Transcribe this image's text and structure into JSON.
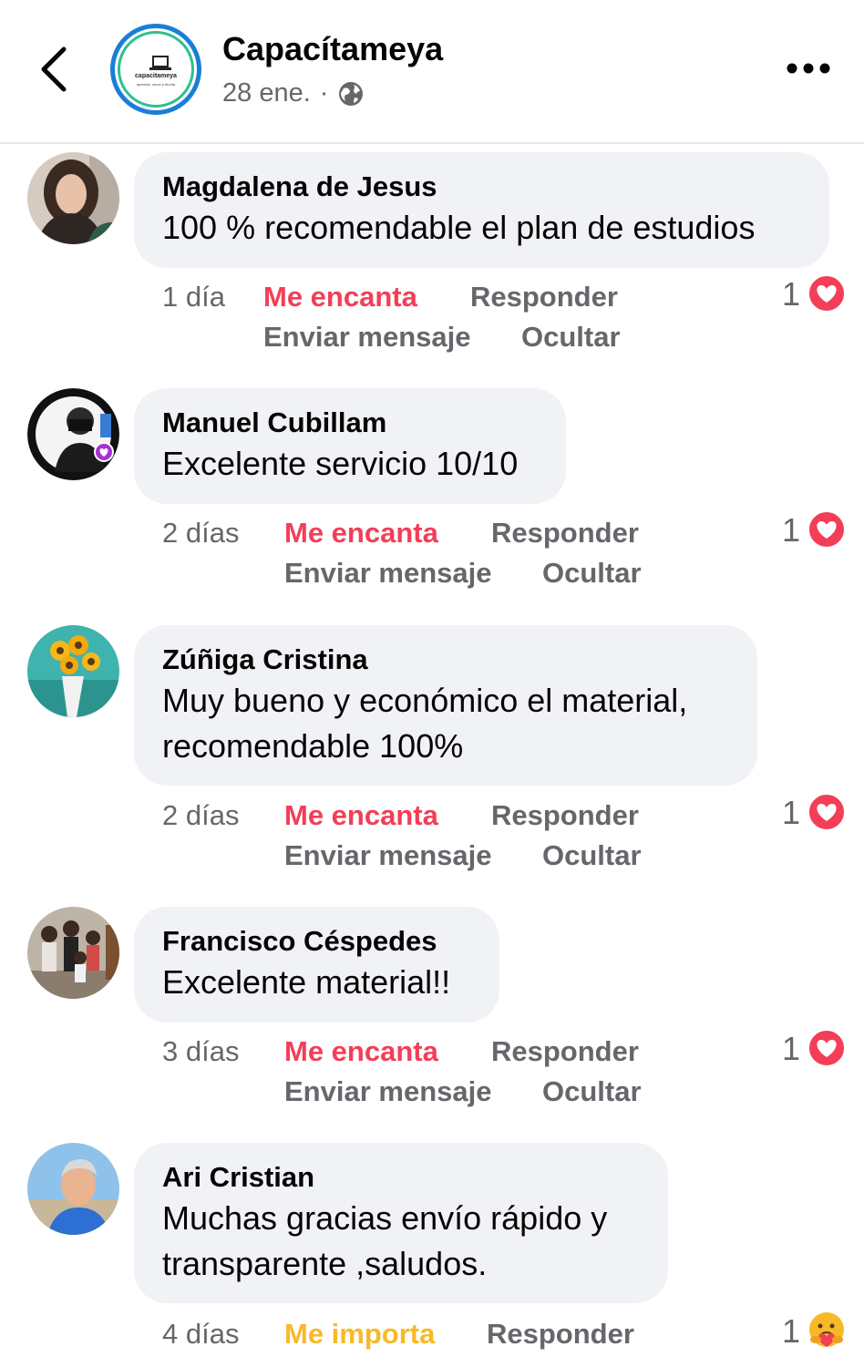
{
  "header": {
    "page_name": "Capacítameya",
    "date": "28 ene.",
    "separator": "·",
    "avatar_brand": "capacitameya",
    "avatar_tagline": "aprende, crece y triunfa"
  },
  "colors": {
    "love": "#f33e58",
    "care": "#f7b928",
    "bubble": "#f0f2f5",
    "secondary_text": "#65676b"
  },
  "comments": [
    {
      "author": "Magdalena de Jesus",
      "lines": [
        "100 % recomendable el plan de estudios"
      ],
      "time": "1 día",
      "reaction_label": "Me encanta",
      "reply_label": "Responder",
      "message_label": "Enviar mensaje",
      "hide_label": "Ocultar",
      "reaction_count": "1",
      "reaction_icon": "love-reaction-icon"
    },
    {
      "author": "Manuel Cubillam",
      "lines": [
        "Excelente servicio 10/10"
      ],
      "time": "2 días",
      "reaction_label": "Me encanta",
      "reply_label": "Responder",
      "message_label": "Enviar mensaje",
      "hide_label": "Ocultar",
      "reaction_count": "1",
      "reaction_icon": "love-reaction-icon"
    },
    {
      "author": "Zúñiga Cristina",
      "lines": [
        "Muy bueno y económico el material,",
        "recomendable 100%"
      ],
      "time": "2 días",
      "reaction_label": "Me encanta",
      "reply_label": "Responder",
      "message_label": "Enviar mensaje",
      "hide_label": "Ocultar",
      "reaction_count": "1",
      "reaction_icon": "love-reaction-icon"
    },
    {
      "author": "Francisco Céspedes",
      "lines": [
        "Excelente material!!"
      ],
      "time": "3 días",
      "reaction_label": "Me encanta",
      "reply_label": "Responder",
      "message_label": "Enviar mensaje",
      "hide_label": "Ocultar",
      "reaction_count": "1",
      "reaction_icon": "love-reaction-icon"
    },
    {
      "author": "Ari Cristian",
      "lines": [
        "Muchas gracias envío rápido y",
        "transparente ,saludos."
      ],
      "time": "4 días",
      "reaction_label": "Me importa",
      "reply_label": "Responder",
      "reaction_count": "1",
      "reaction_icon": "care-reaction-icon"
    }
  ]
}
